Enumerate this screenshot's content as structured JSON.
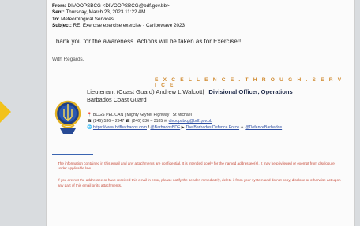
{
  "email": {
    "from_label": "From:",
    "from_value": "DIVOOPSBCG <DIVOOPSBCG@bdf.gov.bb>",
    "sent_label": "Sent:",
    "sent_value": "Thursday, March 23, 2023 11:22 AM",
    "to_label": "To:",
    "to_value": "Meteorological Services",
    "subject_label": "Subject:",
    "subject_value": "RE: Exercise exercise exercise - Caribewave 2023",
    "body_line1": "Thank you for the awareness.  Actions will be taken as for Exercise!!!",
    "body_line2": "With Regards,"
  },
  "signature": {
    "tagline": "E X C E L L E N C E . T H R O U G H . S E R V I C E",
    "name": "Lieutenant (Coast Guard) Andrew L Walcott|",
    "role": "Divisional Officer, Operations",
    "org": "Barbados Coast Guard",
    "address": "BCGS PELICAN | Mighty Gryner Highway | St Michael",
    "phones": "(246) 536 – 2947 ☎ (246) 836 – 3185",
    "email": "divoopsbcg@bdf.gov.bb",
    "website": "https://www.bdfbarbados.com",
    "social1": "@BarbadosBDF",
    "social2": "The Barbados Defence Force",
    "social3": "@DefenceBarbados"
  },
  "footer": {
    "line1": "The information contained in this email and any attachments are confidential. It is intended solely for the named addressee(s). It may be privileged or exempt from disclosure under applicable law.",
    "line2": "If you are not the addressee or have received this email in error, please notify the sender immediately, delete it from your system and do not copy, disclose or otherwise act upon any part of this email or its attachments."
  },
  "colors": {
    "background": "#d9dcdf",
    "email_bg": "#fbfbfb",
    "tagline": "#d08a2f",
    "link": "#2d4ea3",
    "footer_text": "#c64a39",
    "arrow": "#f2c21b"
  }
}
